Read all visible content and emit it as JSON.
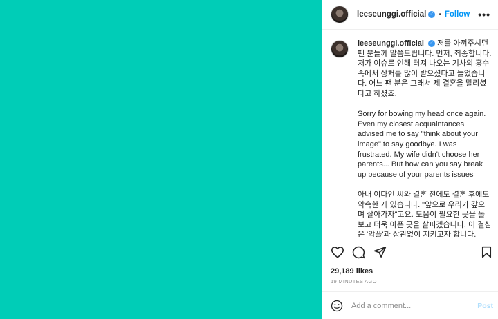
{
  "post": {
    "username": "leeseunggi.official",
    "verified_icon": "verified-badge-icon",
    "separator": "•",
    "follow_label": "Follow",
    "more_icon": "more-options-icon",
    "more_glyph": "•••",
    "media_color": "#00cdb7",
    "caption": {
      "paragraph_1": "저를 아껴주시던 팬 분들께 말씀드립니다. 먼저, 죄송합니다. 저가 이슈로 인해 터져 나오는 기사의 홍수 속에서 상처를 많이 받으셨다고 들었습니다. 어느 팬 분은 그래서 제 결혼을 말리셨다고 하셨죠.",
      "paragraph_2": "Sorry for bowing my head once again. Even my closest acquaintances advised me to say \"think about your image\" to say goodbye. I was frustrated. My wife didn't choose her parents... But how can you say break up because of your parents issues",
      "paragraph_3": "아내 이다인 씨와 결혼 전에도 결혼 후에도 약속한 게 있습니다. \"앞으로 우리가 갚으며 살아가자\"고요. 도움이 필요한 곳을 돌보고 더욱 아픈 곳을 살피겠습니다. 이 결심은 '악플'과 상관없이 지키고자 합니다."
    },
    "likes": "29,189 likes",
    "time_ago": "19 MINUTES AGO",
    "comment": {
      "placeholder": "Add a comment...",
      "post_label": "Post",
      "emoji_icon": "emoji-icon"
    },
    "action_icons": [
      "heart-icon",
      "comment-icon",
      "share-icon",
      "bookmark-icon"
    ]
  }
}
